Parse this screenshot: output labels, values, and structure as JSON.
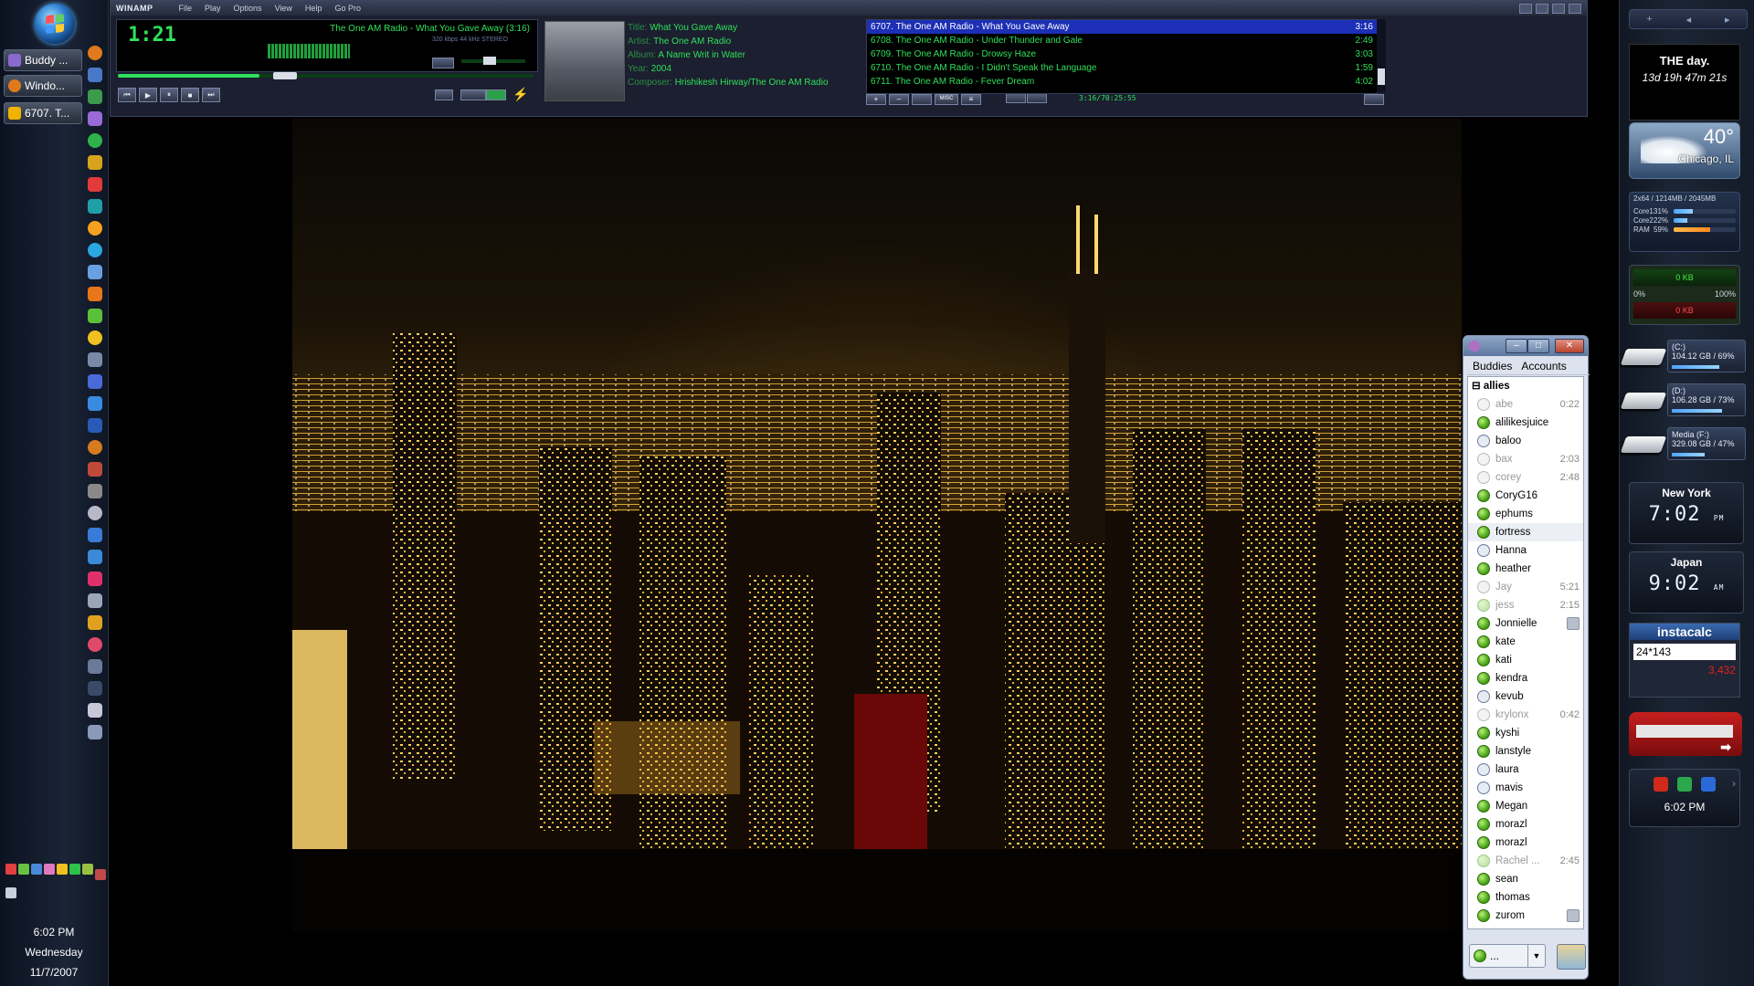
{
  "taskbar": {
    "windows": [
      {
        "label": "Buddy ...",
        "icon": "pidgin-icon",
        "color": "#8a6ad0"
      },
      {
        "label": "Windo...",
        "icon": "firefox-icon",
        "color": "#e07a1c"
      },
      {
        "label": "6707. T...",
        "icon": "winamp-icon",
        "color": "#f0b400"
      }
    ],
    "clock": {
      "time": "6:02 PM",
      "day": "Wednesday",
      "date": "11/7/2007"
    }
  },
  "winamp": {
    "brand": "WINAMP",
    "menu": [
      "File",
      "Play",
      "Options",
      "View",
      "Help",
      "Go Pro"
    ],
    "time": "1:21",
    "song_title": "The One AM Radio - What You Gave Away (3:16)",
    "bitrate": "320",
    "khz": "44",
    "mode": "STEREO",
    "progress": 0.34,
    "meta": {
      "title_label": "Title:",
      "title": "What You Gave Away",
      "artist_label": "Artist:",
      "artist": "The One AM Radio",
      "album_label": "Album:",
      "album": "A Name Writ in Water",
      "year_label": "Year:",
      "year": "2004",
      "composer_label": "Composer:",
      "composer": "Hrishikesh Hirway/The One AM Radio"
    },
    "playlist": [
      {
        "title": "6707. The One AM Radio - What You Gave Away",
        "length": "3:16"
      },
      {
        "title": "6708. The One AM Radio - Under Thunder and Gale",
        "length": "2:49"
      },
      {
        "title": "6709. The One AM Radio - Drowsy Haze",
        "length": "3:03"
      },
      {
        "title": "6710. The One AM Radio - I Didn't Speak the Language",
        "length": "1:59"
      },
      {
        "title": "6711. The One AM Radio - Fever Dream",
        "length": "4:02"
      }
    ],
    "playlist_time": "3:16/70:25:55",
    "playlist_buttons": [
      "+",
      "–",
      "",
      "MISC",
      "≡"
    ]
  },
  "buddy": {
    "tabs": [
      "Buddies",
      "Accounts"
    ],
    "group": "allies",
    "buddies": [
      {
        "name": "abe",
        "status": "idle",
        "time": "0:22"
      },
      {
        "name": "alilikesjuice",
        "status": "online"
      },
      {
        "name": "baloo",
        "status": "away"
      },
      {
        "name": "bax",
        "status": "idle",
        "time": "2:03"
      },
      {
        "name": "corey",
        "status": "idle",
        "time": "2:48"
      },
      {
        "name": "CoryG16",
        "status": "online"
      },
      {
        "name": "ephums",
        "status": "online"
      },
      {
        "name": "fortress",
        "status": "online",
        "selected": true
      },
      {
        "name": "Hanna",
        "status": "away"
      },
      {
        "name": "heather",
        "status": "online"
      },
      {
        "name": "Jay",
        "status": "idle",
        "time": "5:21"
      },
      {
        "name": "jess",
        "status": "faint",
        "time": "2:15"
      },
      {
        "name": "Jonnielle",
        "status": "online",
        "badge": true
      },
      {
        "name": "kate",
        "status": "online"
      },
      {
        "name": "kati",
        "status": "online"
      },
      {
        "name": "kendra",
        "status": "online"
      },
      {
        "name": "kevub",
        "status": "away"
      },
      {
        "name": "krylonx",
        "status": "idle",
        "time": "0:42"
      },
      {
        "name": "kyshi",
        "status": "online"
      },
      {
        "name": "lanstyle",
        "status": "online"
      },
      {
        "name": "laura",
        "status": "away"
      },
      {
        "name": "mavis",
        "status": "away"
      },
      {
        "name": "Megan",
        "status": "online"
      },
      {
        "name": "morazl",
        "status": "online"
      },
      {
        "name": "morazl",
        "status": "online"
      },
      {
        "name": "Rachel ...",
        "status": "faint",
        "time": "2:45"
      },
      {
        "name": "sean",
        "status": "online"
      },
      {
        "name": "thomas",
        "status": "online"
      },
      {
        "name": "zurom",
        "status": "online",
        "badge": true
      }
    ],
    "status_label": "..."
  },
  "sidebar": {
    "day": {
      "title": "THE day.",
      "countdown": "13d 19h 47m 21s"
    },
    "weather": {
      "temp": "40°",
      "city": "Chicago, IL"
    },
    "meter": {
      "header": "2x64 / 1214MB / 2045MB",
      "rows": [
        {
          "label": "Core1",
          "pct": "31%",
          "value": 0.31
        },
        {
          "label": "Core2",
          "pct": "22%",
          "value": 0.22
        },
        {
          "label": "RAM",
          "pct": "59%",
          "value": 0.59
        }
      ]
    },
    "network": {
      "up": "0 KB",
      "down": "0 KB",
      "min": "0%",
      "max": "100%"
    },
    "drives": [
      {
        "name": "(C:)",
        "info": "104.12 GB / 69%",
        "value": 0.69
      },
      {
        "name": "(D:)",
        "info": "106.28 GB / 73%",
        "value": 0.73
      },
      {
        "name": "Media (F:)",
        "info": "329.08 GB / 47%",
        "value": 0.47
      }
    ],
    "clocks": [
      {
        "city": "New York",
        "time": "7:02",
        "ampm": "PM"
      },
      {
        "city": "Japan",
        "time": "9:02",
        "ampm": "AM"
      }
    ],
    "calc": {
      "title": "instacalc",
      "input": "24*143",
      "result": "3,432"
    },
    "control_time": "6:02 PM"
  }
}
